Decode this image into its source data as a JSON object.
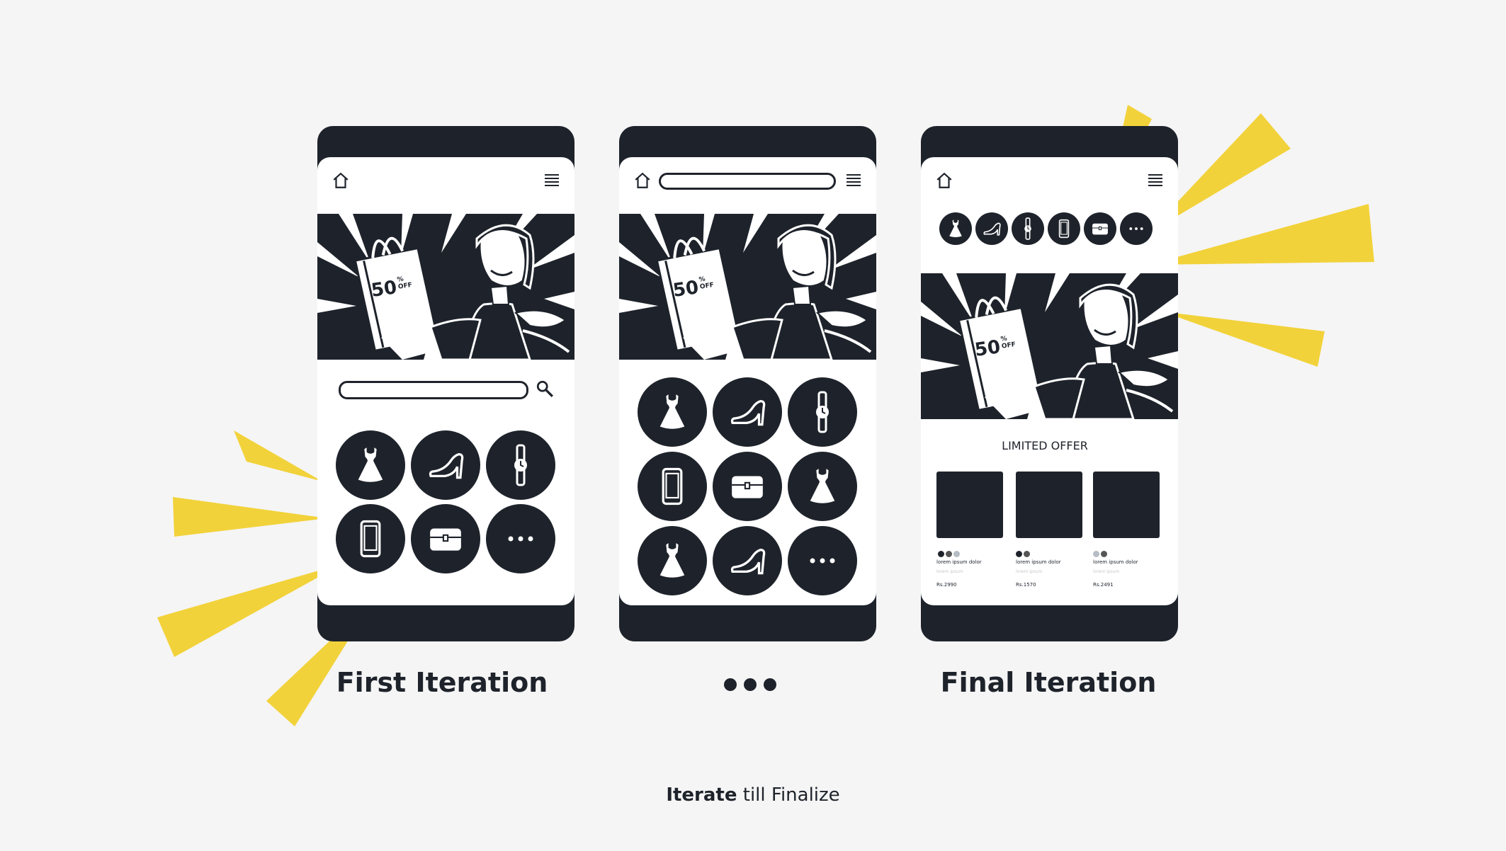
{
  "captions": {
    "first": "First Iteration",
    "final": "Final Iteration",
    "footer_bold": "Iterate",
    "footer_rest": " till Finalize"
  },
  "banner": {
    "discount": "50",
    "pct": "%",
    "off": "OFF"
  },
  "final": {
    "section_title": "LIMITED OFFER",
    "products": [
      {
        "name": "lorem ipsum dolor",
        "sub": "lorem ipsum",
        "price": "Rs.2990"
      },
      {
        "name": "lorem ipsum dolor",
        "sub": "lorem ipsum",
        "price": "Rs.1570"
      },
      {
        "name": "lorem ipsum dolor",
        "sub": "lorem ipsum",
        "price": "Rs.2491"
      }
    ]
  },
  "colors": {
    "dark": "#1e232b",
    "accent": "#f2d23a",
    "background": "#f5f5f5"
  },
  "icons": [
    "home-icon",
    "menu-icon",
    "search-icon",
    "dress-icon",
    "heel-icon",
    "watch-icon",
    "phone-icon",
    "bag-icon",
    "more-icon"
  ]
}
